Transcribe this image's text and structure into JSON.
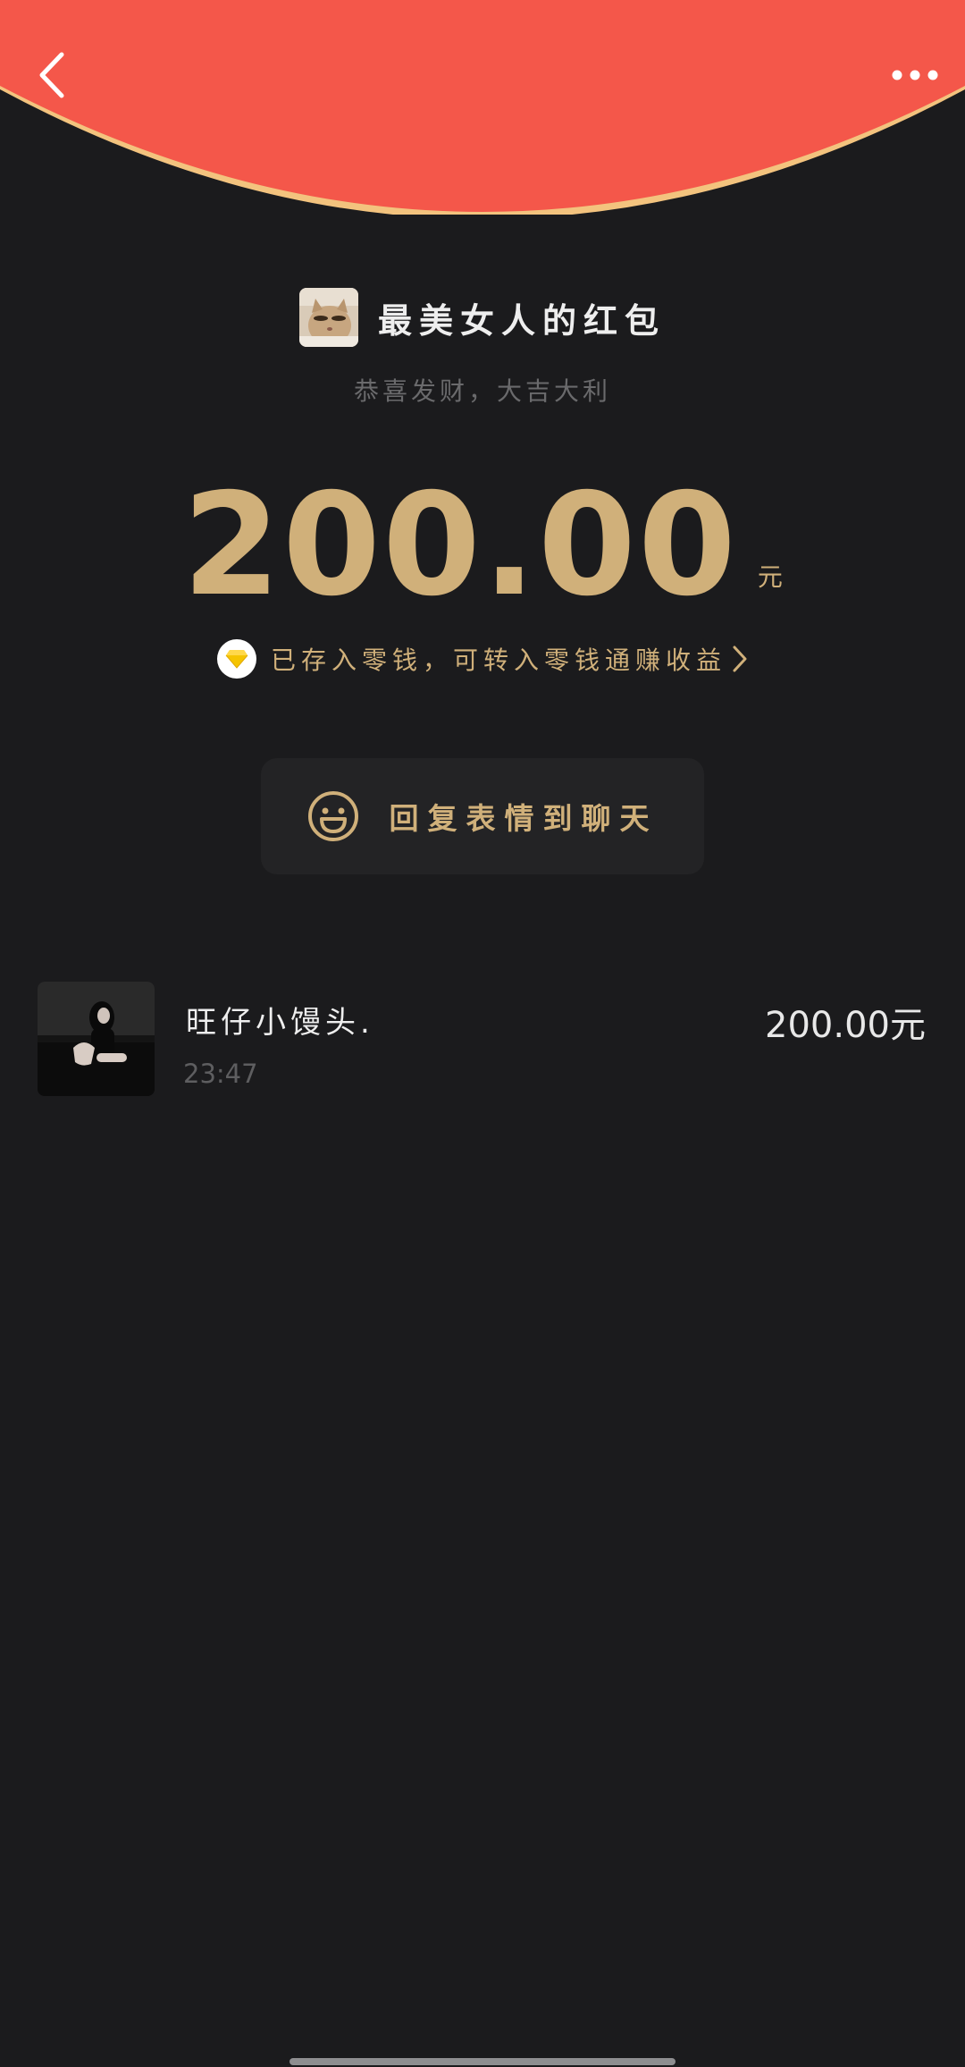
{
  "theme": {
    "header_red": "#f4574a",
    "header_rim": "#f3c37e",
    "gold": "#d0b07a",
    "background": "#1b1b1d"
  },
  "header": {
    "back_icon": "chevron-left-icon",
    "more_icon": "more-dots-icon"
  },
  "sender": {
    "title": "最美女人的红包",
    "blessing": "恭喜发财，大吉大利",
    "avatar": "cat-avatar"
  },
  "amount": {
    "value": "200.00",
    "unit": "元"
  },
  "change_notice": {
    "text": "已存入零钱，可转入零钱通赚收益",
    "icon": "diamond-icon",
    "chevron": "chevron-right-icon"
  },
  "reply_button": {
    "label": "回复表情到聊天",
    "icon": "smiley-icon"
  },
  "receivers": [
    {
      "name": "旺仔小馒头.",
      "time": "23:47",
      "amount": "200.00元"
    }
  ]
}
